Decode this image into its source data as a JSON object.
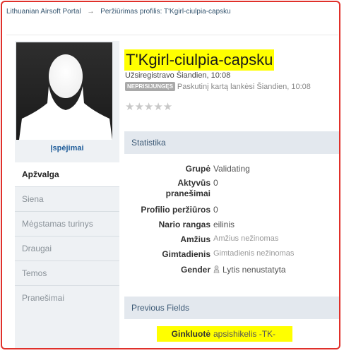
{
  "breadcrumb": {
    "items": [
      "Lithuanian Airsoft Portal",
      "Peržiūrimas profilis: T'Kgirl-ciulpia-capsku"
    ],
    "separator": "→"
  },
  "sidebar": {
    "warnings_label": "Įspėjimai",
    "items": [
      {
        "label": "Apžvalga",
        "active": true
      },
      {
        "label": "Siena",
        "active": false
      },
      {
        "label": "Mėgstamas turinys",
        "active": false
      },
      {
        "label": "Draugai",
        "active": false
      },
      {
        "label": "Temos",
        "active": false
      },
      {
        "label": "Pranešimai",
        "active": false
      }
    ]
  },
  "profile": {
    "name": "T'Kgirl-ciulpia-capsku",
    "registered": "Užsiregistravo Šiandien, 10:08",
    "status_badge": "NEPRISIJUNGĘS",
    "last_visit": "Paskutinį kartą lankėsi Šiandien, 10:08",
    "rating_stars": "★★★★★"
  },
  "stats": {
    "title": "Statistika",
    "rows": [
      {
        "label": "Grupė",
        "value": "Validating"
      },
      {
        "label": "Aktyvūs pranešimai",
        "value": "0"
      },
      {
        "label": "Profilio peržiūros",
        "value": "0"
      },
      {
        "label": "Nario rangas",
        "value": "eilinis"
      },
      {
        "label": "Amžius",
        "value": "Amžius nežinomas"
      },
      {
        "label": "Gimtadienis",
        "value": "Gimtadienis nežinomas"
      },
      {
        "label": "Gender",
        "value": "Lytis nenustatyta"
      }
    ]
  },
  "previous_fields": {
    "title": "Previous Fields",
    "rows": [
      {
        "label": "Ginkluotė",
        "value": "apsishikelis -TK-"
      }
    ]
  },
  "colors": {
    "highlight": "#ffff00",
    "frame_border": "#e0302a",
    "section_bg": "#e3e8ee",
    "link": "#1f5d9a"
  }
}
